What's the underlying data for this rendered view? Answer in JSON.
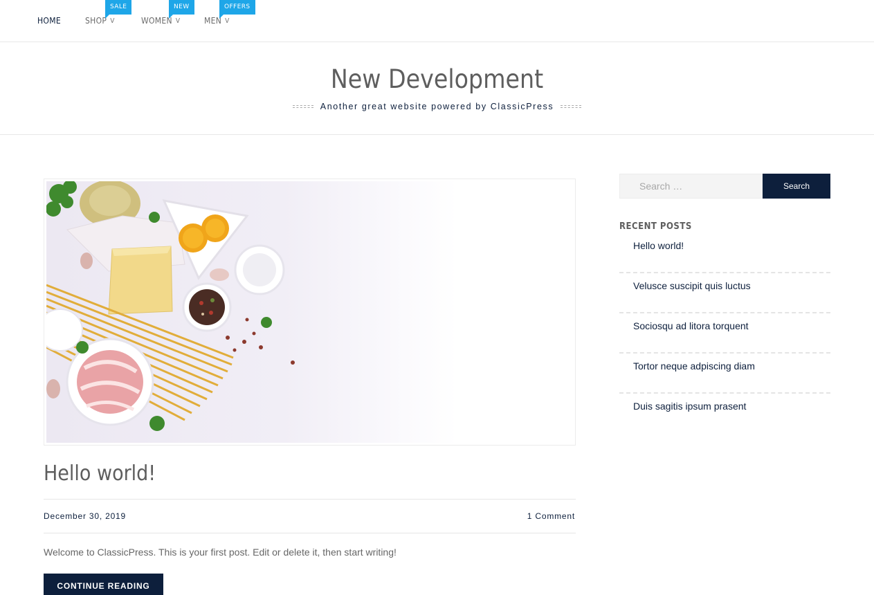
{
  "nav": {
    "items": [
      {
        "label": "HOME",
        "active": true
      },
      {
        "label": "SHOP",
        "chevron": "v",
        "badge": "SALE"
      },
      {
        "label": "WOMEN",
        "chevron": "v",
        "badge": "NEW"
      },
      {
        "label": "MEN",
        "chevron": "v",
        "badge": "OFFERS"
      }
    ]
  },
  "header": {
    "title": "New Development",
    "tagline": "Another great website powered by ClassicPress"
  },
  "post": {
    "title": "Hello world!",
    "date": "December 30, 2019",
    "comments": "1 Comment",
    "excerpt": "Welcome to ClassicPress. This is your first post. Edit or delete it, then start writing!",
    "continue_label": "CONTINUE READING"
  },
  "sidebar": {
    "search": {
      "placeholder": "Search …",
      "button_label": "Search"
    },
    "recent_title": "RECENT POSTS",
    "recent_posts": [
      "Hello world!",
      "Velusce suscipit quis luctus",
      "Sociosqu ad litora torquent",
      "Tortor neque adpiscing diam",
      "Duis sagitis ipsum prasent"
    ]
  },
  "colors": {
    "navy": "#0d1f3c",
    "badge_blue": "#1ea6e8",
    "heading_grey": "#5e5e5e"
  }
}
